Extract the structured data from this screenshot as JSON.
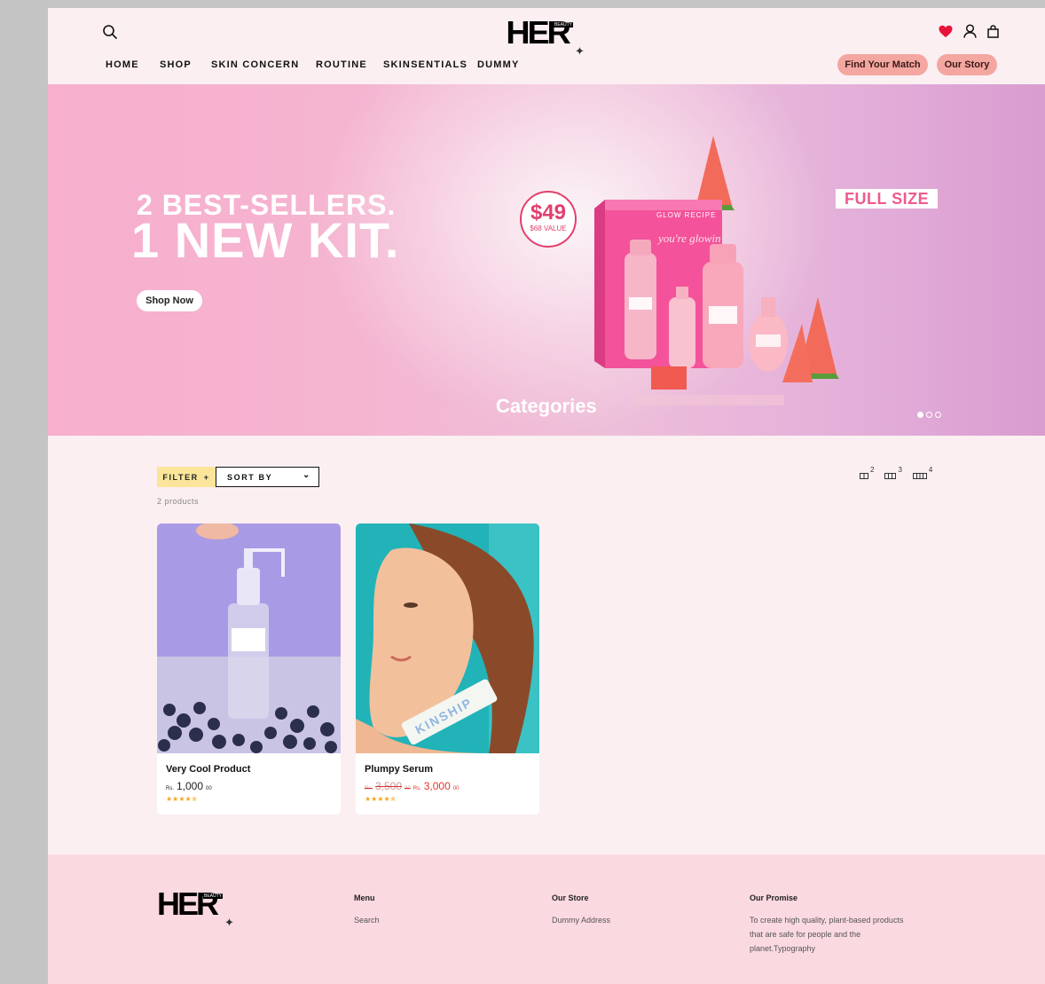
{
  "header": {
    "logo_text": "HER",
    "logo_sub": "BEAUTY",
    "nav": [
      "HOME",
      "SHOP",
      "SKIN CONCERN",
      "ROUTINE",
      "SKINSENTIALS",
      "DUMMY"
    ],
    "find_match_label": "Find Your Match",
    "our_story_label": "Our Story",
    "icons": [
      "search-icon",
      "heart-icon",
      "account-icon",
      "bag-icon"
    ],
    "heart_color": "#e8123a"
  },
  "hero": {
    "line1": "2 BEST-SELLERS.",
    "line2": "1 NEW KIT.",
    "cta_label": "Shop Now",
    "price": "$49",
    "price_sub": "$68 VALUE",
    "tag": "FULL SIZE",
    "box_brand": "GLOW RECIPE",
    "box_text": "you're glowin",
    "overlay_title": "Categories",
    "slides": 3,
    "active_slide": 1
  },
  "listing": {
    "filter_label": "FILTER",
    "sort_label": "SORT BY",
    "count_text": "2 products",
    "grid_options": [
      "2",
      "3",
      "4"
    ]
  },
  "products": [
    {
      "title": "Very Cool Product",
      "currency": "Rs.",
      "price_main": "1,000",
      "price_cents": "00",
      "rating": 4.5,
      "stars": "★★★★✯"
    },
    {
      "title": "Plumpy Serum",
      "currency": "Rs.",
      "compare_main": "3,500",
      "compare_cents": "00",
      "price_main": "3,000",
      "price_cents": "00",
      "rating": 4.5,
      "stars": "★★★★✯",
      "tube_text": "KINSHIP"
    }
  ],
  "footer": {
    "logo_text": "HER",
    "logo_sub": "BEAUTY",
    "menu_heading": "Menu",
    "menu_links": [
      "Search"
    ],
    "store_heading": "Our Store",
    "store_text": "Dummy Address",
    "promise_heading": "Our Promise",
    "promise_line1": "To create high quality, plant-based products",
    "promise_line2": "that are safe for people and the",
    "promise_line3": "planet.Typography"
  }
}
